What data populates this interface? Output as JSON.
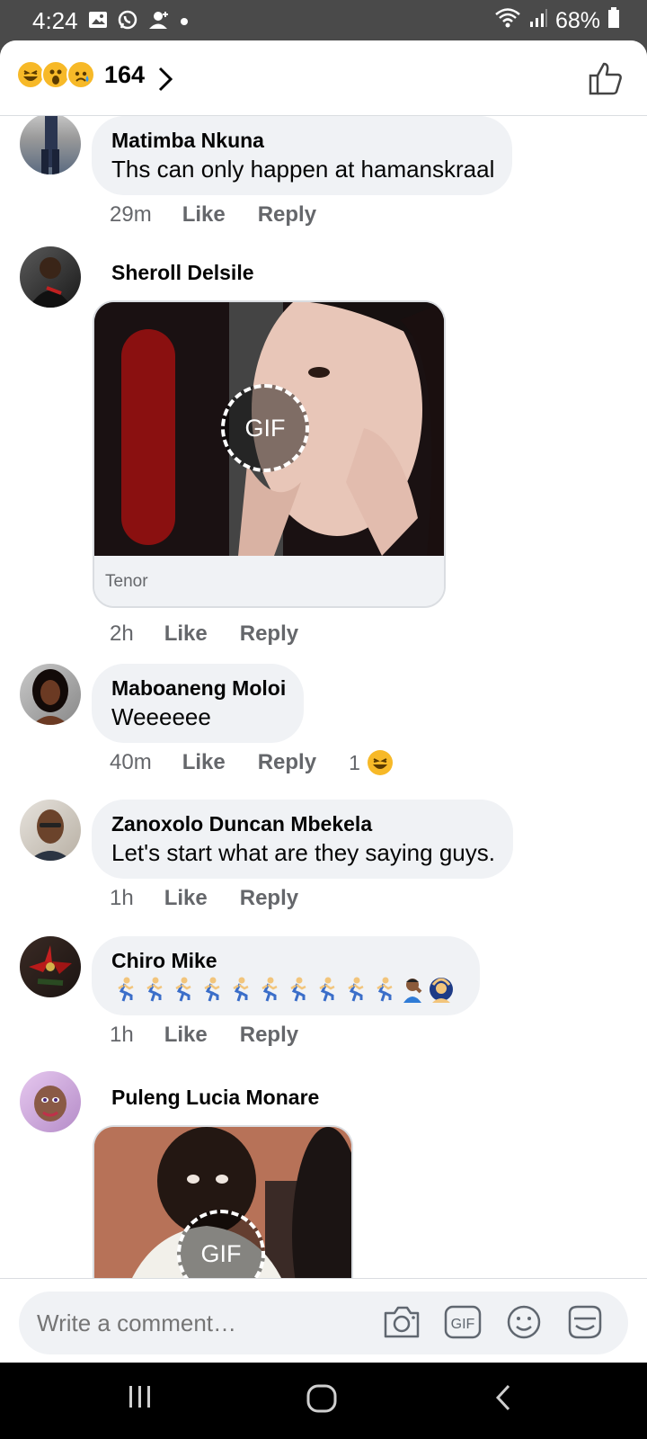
{
  "status_bar": {
    "time": "4:24",
    "battery": "68%",
    "icons": [
      "gallery-icon",
      "whatsapp-icon",
      "add-contact-icon",
      "dot-icon",
      "wifi-icon",
      "signal-icon",
      "battery-icon"
    ]
  },
  "header": {
    "reaction_icons": [
      "laugh-emoji-icon",
      "wow-emoji-icon",
      "sad-emoji-icon"
    ],
    "reaction_count": "164",
    "like_icon": "thumbs-up-icon"
  },
  "comments": [
    {
      "author": "Matimba Nkuna",
      "text": "Ths can only happen at hamanskraal",
      "time": "29m",
      "like": "Like",
      "reply": "Reply"
    },
    {
      "author": "Sheroll Delsile",
      "gif_source": "Tenor",
      "gif_badge": "GIF",
      "time": "2h",
      "like": "Like",
      "reply": "Reply"
    },
    {
      "author": "Maboaneng Moloi",
      "text": "Weeeeee",
      "time": "40m",
      "like": "Like",
      "reply": "Reply",
      "reaction_count": "1",
      "reaction_icon": "laugh-emoji-icon"
    },
    {
      "author": "Zanoxolo Duncan Mbekela",
      "text": "Let's start what are they saying guys.",
      "time": "1h",
      "like": "Like",
      "reply": "Reply"
    },
    {
      "author": "Chiro Mike",
      "emoji_sequence": [
        "running-man",
        "running-man",
        "running-man",
        "running-man",
        "running-man",
        "running-man",
        "running-man",
        "running-man",
        "running-man",
        "running-man",
        "facepalm",
        "person-gesturing-ok"
      ],
      "time": "1h",
      "like": "Like",
      "reply": "Reply"
    },
    {
      "author": "Puleng Lucia Monare",
      "gif_badge": "GIF"
    }
  ],
  "composer": {
    "placeholder": "Write a comment…",
    "icons": [
      "camera-icon",
      "gif-icon",
      "emoji-icon",
      "sticker-icon"
    ]
  },
  "nav_bar": {
    "buttons": [
      "recent-apps-button",
      "home-button",
      "back-button"
    ]
  },
  "colors": {
    "bubble": "#f0f2f5",
    "meta_text": "#65676b",
    "emoji_yellow": "#f7b928",
    "status_bar": "#4a4a4a"
  }
}
